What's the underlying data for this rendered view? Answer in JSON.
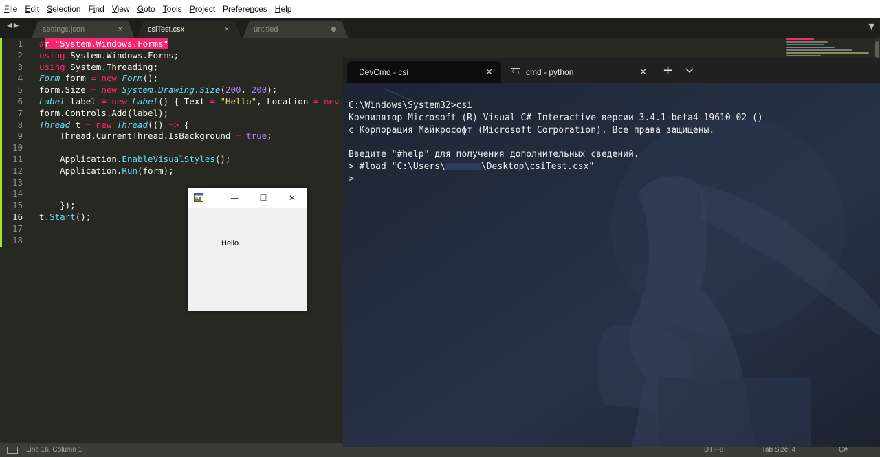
{
  "editor_app": {
    "menu": [
      {
        "pre": "",
        "ul": "F",
        "post": "ile"
      },
      {
        "pre": "",
        "ul": "E",
        "post": "dit"
      },
      {
        "pre": "",
        "ul": "S",
        "post": "election"
      },
      {
        "pre": "F",
        "ul": "i",
        "post": "nd"
      },
      {
        "pre": "",
        "ul": "V",
        "post": "iew"
      },
      {
        "pre": "",
        "ul": "G",
        "post": "oto"
      },
      {
        "pre": "",
        "ul": "T",
        "post": "ools"
      },
      {
        "pre": "",
        "ul": "P",
        "post": "roject"
      },
      {
        "pre": "Prefere",
        "ul": "n",
        "post": "ces"
      },
      {
        "pre": "",
        "ul": "H",
        "post": "elp"
      }
    ],
    "tabs": [
      {
        "label": "settings.json",
        "state": "close"
      },
      {
        "label": "csiTest.csx",
        "state": "active"
      },
      {
        "label": "untitled",
        "state": "modified"
      }
    ],
    "close_glyph": "×",
    "nav_arrows": "◀▶",
    "tab_dropdown_glyph": "▼",
    "line_numbers": [
      "1",
      "2",
      "3",
      "4",
      "5",
      "6",
      "7",
      "8",
      "9",
      "10",
      "11",
      "12",
      "13",
      "14",
      "15",
      "16",
      "17",
      "18"
    ],
    "current_line": 16,
    "code": {
      "l1": {
        "hash": "#",
        "sel": "r \"System.Windows.Forms\""
      },
      "l2": {
        "kw": "using",
        "rest": " System.Windows.Forms;"
      },
      "l3": {
        "kw": "using",
        "rest": " System.Threading;"
      },
      "l4": {
        "t1": "Form",
        "a": " form ",
        "op": "=",
        "sp": " ",
        "new": "new",
        "sp2": " ",
        "t2": "Form",
        "end": "();"
      },
      "l5": {
        "a": "form.Size ",
        "op": "=",
        "sp": " ",
        "new": "new",
        "sp2": " ",
        "t2": "System.Drawing.Size",
        "p1": "(",
        "n1": "200",
        "c": ", ",
        "n2": "200",
        "end": ");"
      },
      "l6": {
        "t1": "Label",
        "a": " label ",
        "op": "=",
        "sp": " ",
        "new": "new",
        "sp2": " ",
        "t2": "Label",
        "b": "() { Text ",
        "op2": "=",
        "sp3": " ",
        "s": "\"Hello\"",
        "c": ", Location ",
        "op3": "=",
        "sp4": " ",
        "new2": "nev"
      },
      "l7": {
        "a": "form.Controls.Add(label);"
      },
      "l8": {
        "t1": "Thread",
        "a": " t ",
        "op": "=",
        "sp": " ",
        "new": "new",
        "sp2": " ",
        "t2": "Thread",
        "b": "(() ",
        "arrow": "=>",
        "end": " {"
      },
      "l9": {
        "a": "    Thread.CurrentThread.IsBackground ",
        "op": "=",
        "sp": " ",
        "val": "true",
        "end": ";"
      },
      "l11": {
        "a": "    Application.",
        "fn": "EnableVisualStyles",
        "end": "();"
      },
      "l12": {
        "a": "    Application.",
        "fn": "Run",
        "end": "(form);"
      },
      "l15": {
        "a": "    });"
      },
      "l16": {
        "a": "t.",
        "fn": "Start",
        "end": "();"
      }
    },
    "status": {
      "position": "Line 16, Column 1",
      "encoding": "UTF-8",
      "tab_size": "Tab Size: 4",
      "syntax": "C#"
    }
  },
  "winform": {
    "min_glyph": "—",
    "max_glyph": "☐",
    "close_glyph": "✕",
    "label_text": "Hello"
  },
  "terminal": {
    "tabs": [
      {
        "label": "DevCmd - csi",
        "active": true
      },
      {
        "label": "cmd - python",
        "active": false
      }
    ],
    "close_glyph": "✕",
    "new_tab_glyph": "+",
    "cmd_icon_text": "C:\\",
    "lines": [
      "C:\\Windows\\System32>csi",
      "Компилятор Microsoft (R) Visual C# Interactive версии 3.4.1-beta4-19610-02 ()",
      "с Корпорация Майкрософт (Microsoft Corporation). Все права защищены.",
      "",
      "Введите \"#help\" для получения дополнительных сведений."
    ],
    "load_line": {
      "pre": "> #load \"C:\\Users\\",
      "post": "\\Desktop\\csiTest.csx\""
    },
    "prompt": ">"
  },
  "colors": {
    "editor_bg": "#272822",
    "keyword": "#f92672",
    "type": "#66d9ef",
    "string": "#e6db74",
    "number": "#ae81ff",
    "terminal_bg": "#1f2634"
  }
}
